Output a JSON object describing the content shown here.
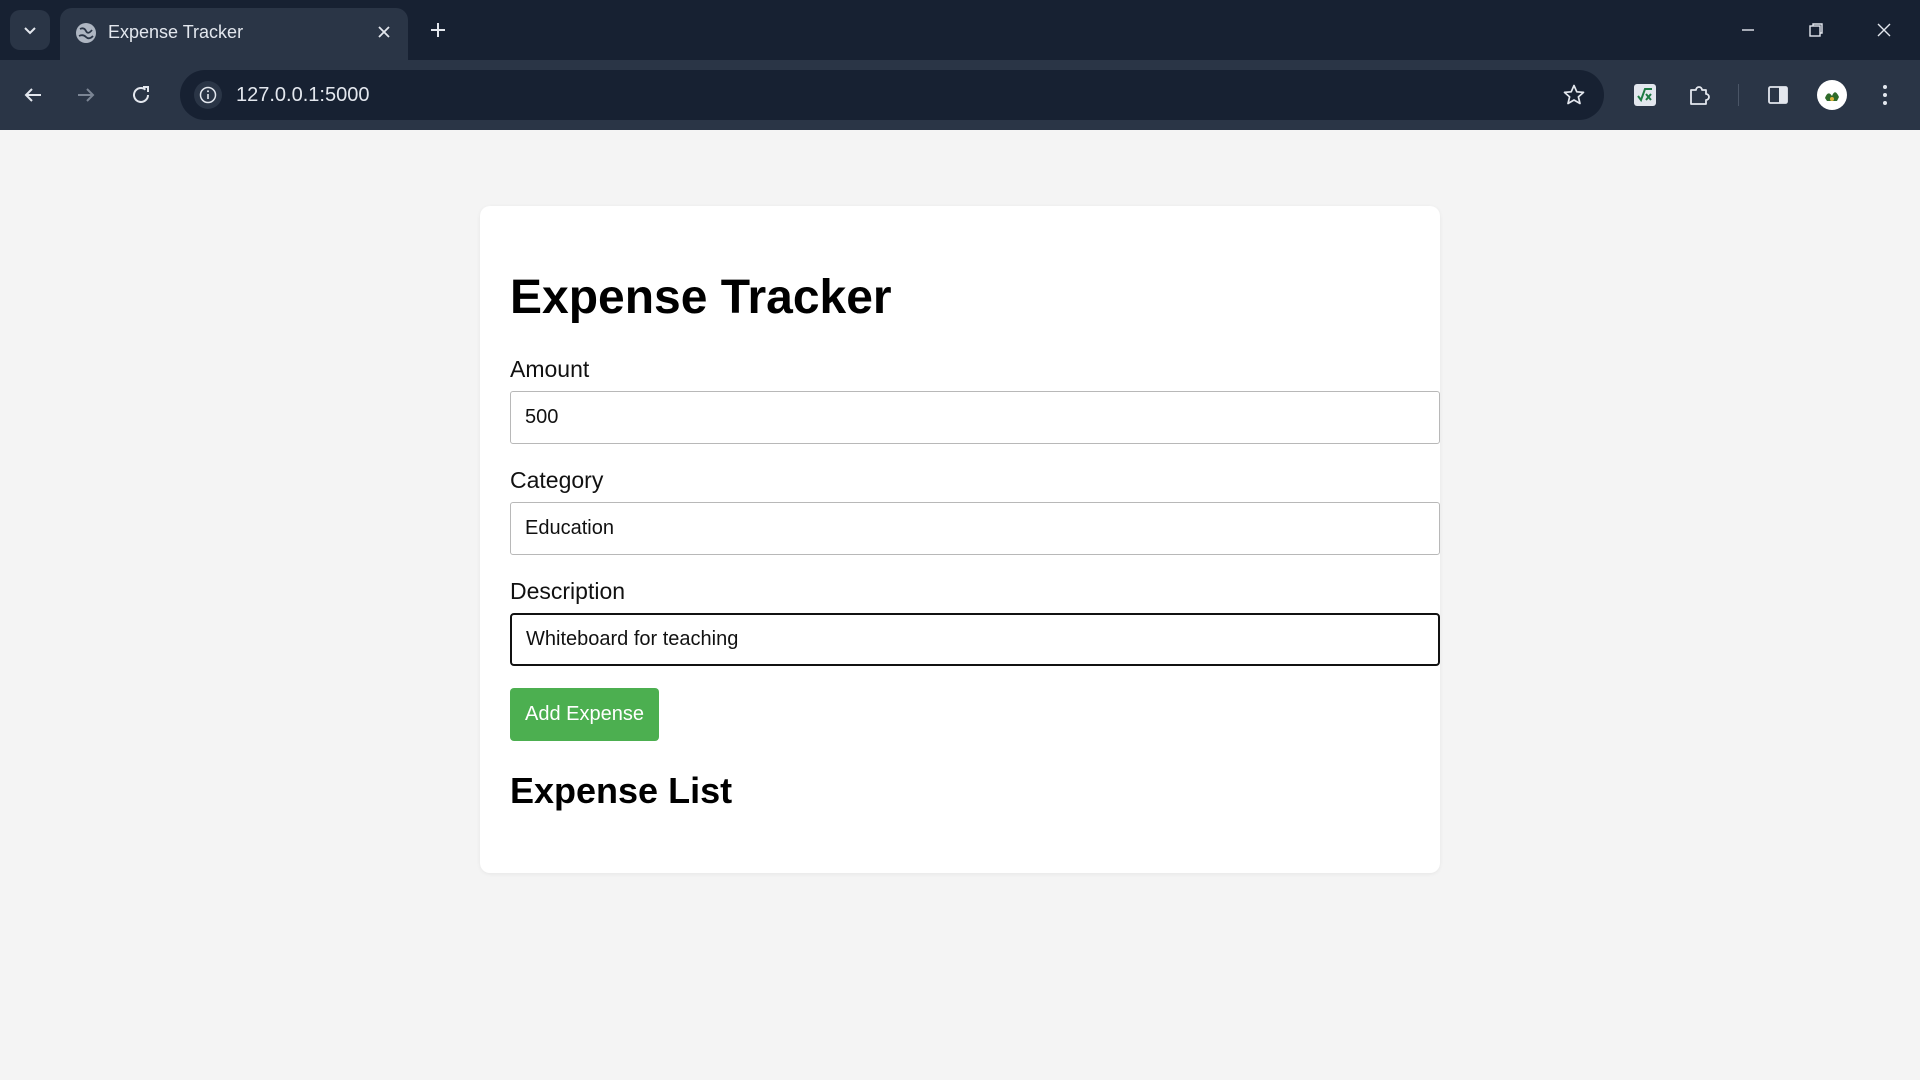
{
  "browser": {
    "tab_title": "Expense Tracker",
    "url": "127.0.0.1:5000"
  },
  "icons": {
    "tab_search": "chevron-down-icon",
    "favicon": "globe-icon",
    "tab_close": "close-icon",
    "new_tab": "plus-icon",
    "minimize": "minimize-icon",
    "restore": "restore-icon",
    "close_window": "close-icon",
    "back": "arrow-left-icon",
    "forward": "arrow-right-icon",
    "reload": "reload-icon",
    "site_info": "info-icon",
    "bookmark": "star-icon",
    "extension_app": "sheet-formula-icon",
    "extensions": "puzzle-icon",
    "side_panel": "side-panel-icon",
    "profile": "avatar-icon",
    "menu": "kebab-menu-icon"
  },
  "colors": {
    "chrome_dark": "#172132",
    "chrome_toolbar": "#2a3546",
    "page_bg": "#f4f4f4",
    "card_bg": "#ffffff",
    "button_green": "#4caf50"
  },
  "page": {
    "title": "Expense Tracker",
    "form": {
      "amount_label": "Amount",
      "amount_value": "500",
      "category_label": "Category",
      "category_value": "Education",
      "description_label": "Description",
      "description_value": "Whiteboard for teaching",
      "submit_label": "Add Expense"
    },
    "list_title": "Expense List",
    "expenses": []
  }
}
